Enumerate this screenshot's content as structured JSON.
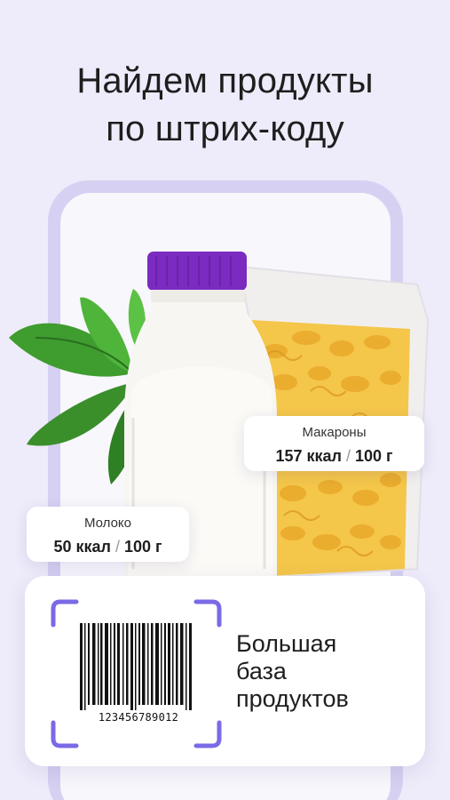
{
  "headline": {
    "line1": "Найдем продукты",
    "line2": "по штрих-коду"
  },
  "products": {
    "pasta": {
      "name": "Макароны",
      "calories": "157 ккал",
      "separator": "/",
      "portion": "100 г"
    },
    "milk": {
      "name": "Молоко",
      "calories": "50 ккал",
      "separator": "/",
      "portion": "100 г"
    }
  },
  "scanner": {
    "barcode_number": "123456789012",
    "caption_line1": "Большая",
    "caption_line2": "база",
    "caption_line3": "продуктов"
  },
  "colors": {
    "background": "#eeebfa",
    "phone_frame": "#d6d0f2",
    "accent_purple": "#7a6ae6",
    "milk_cap": "#7b2bc0"
  }
}
